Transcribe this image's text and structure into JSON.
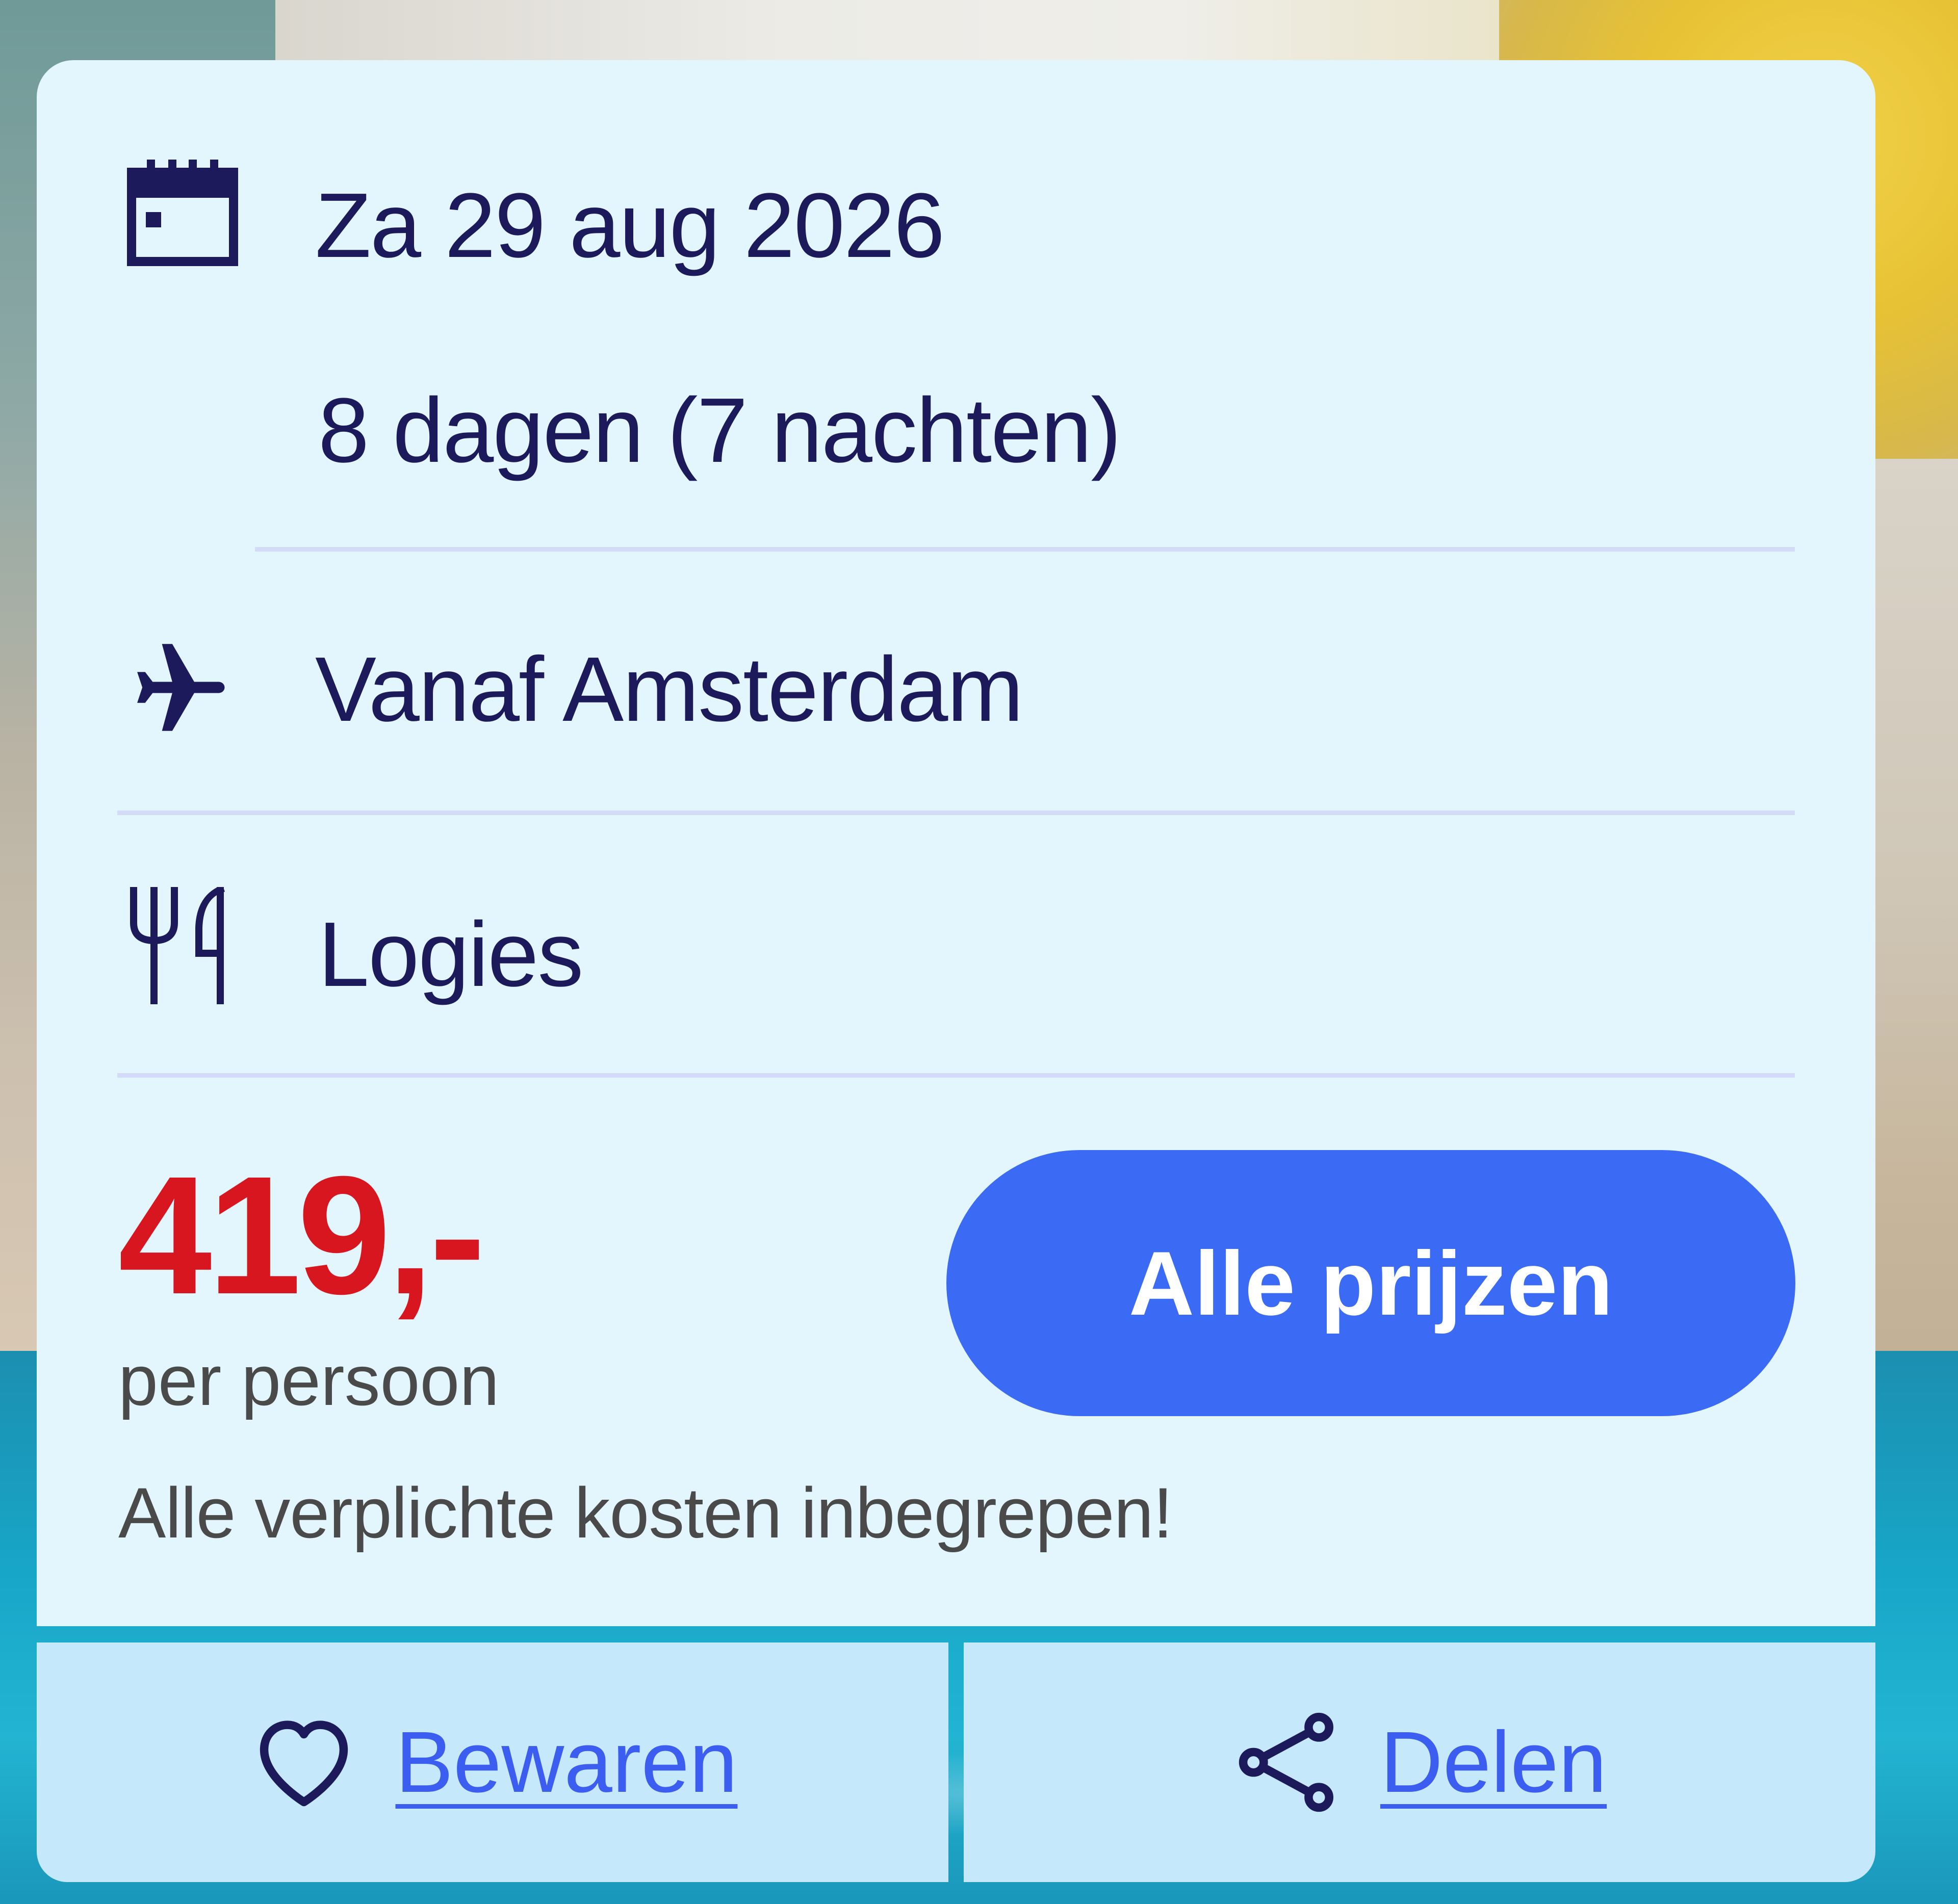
{
  "card": {
    "date": "Za 29 aug 2026",
    "duration": "8 dagen (7 nachten)",
    "departure": "Vanaf Amsterdam",
    "board": "Logies",
    "price": "419,-",
    "price_unit": "per persoon",
    "costs_note": "Alle verplichte kosten inbegrepen!",
    "cta_label": "Alle prijzen"
  },
  "actions": {
    "save_label": "Bewaren",
    "share_label": "Delen"
  },
  "icons": {
    "date": "calendar-icon",
    "departure": "airplane-icon",
    "board": "fork-knife-icon",
    "save": "heart-icon",
    "share": "share-icon"
  },
  "colors": {
    "card_bg": "#e3f5fd",
    "text_primary": "#1c1a5a",
    "price": "#d8161f",
    "button": "#3b6bf4",
    "link": "#3b5df0",
    "action_bg": "#c6e8fb"
  }
}
